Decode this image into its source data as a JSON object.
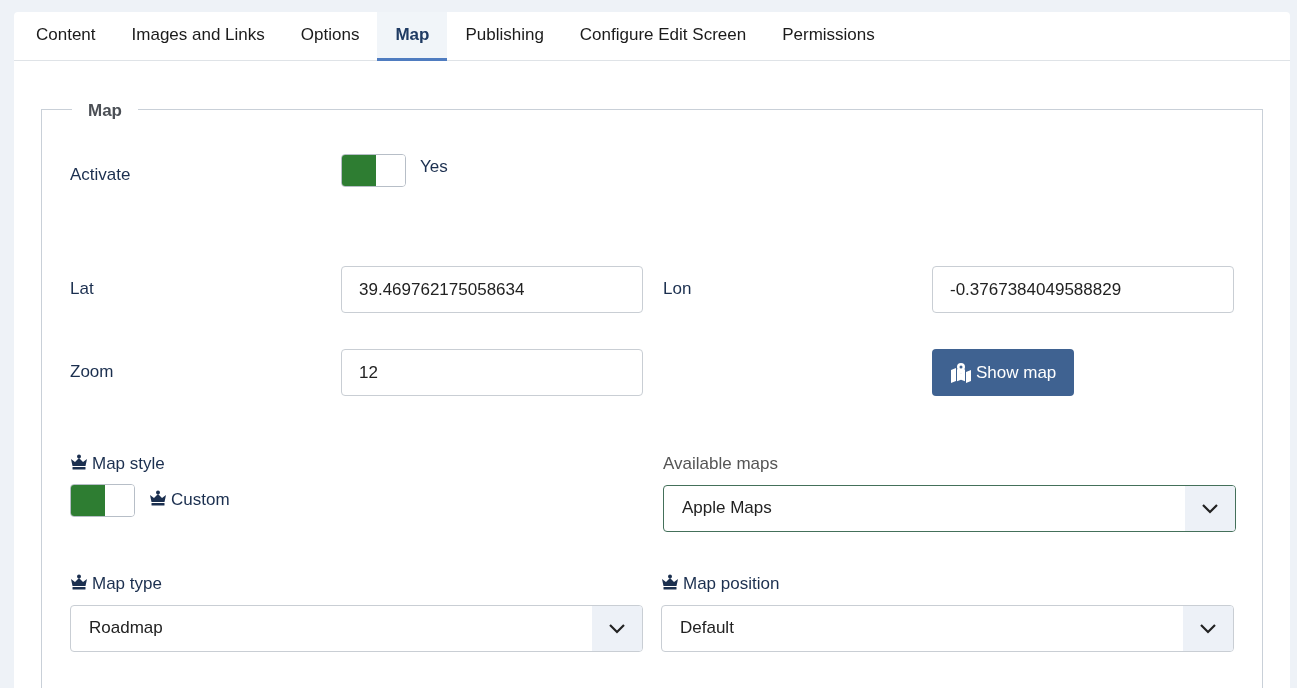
{
  "tabs": [
    {
      "label": "Content",
      "selected": false
    },
    {
      "label": "Images and Links",
      "selected": false
    },
    {
      "label": "Options",
      "selected": false
    },
    {
      "label": "Map",
      "selected": true
    },
    {
      "label": "Publishing",
      "selected": false
    },
    {
      "label": "Configure Edit Screen",
      "selected": false
    },
    {
      "label": "Permissions",
      "selected": false
    }
  ],
  "fieldset": {
    "legend": "Map",
    "activate": {
      "label": "Activate",
      "on": true,
      "state_label": "Yes"
    },
    "lat": {
      "label": "Lat",
      "value": "39.469762175058634"
    },
    "lon": {
      "label": "Lon",
      "value": "-0.3767384049588829"
    },
    "zoom": {
      "label": "Zoom",
      "value": "12"
    },
    "show_map_button": "Show map",
    "map_style": {
      "label": "Map style",
      "on": true,
      "state_label": "Custom"
    },
    "available_maps": {
      "label": "Available maps",
      "value": "Apple Maps"
    },
    "map_type": {
      "label": "Map type",
      "value": "Roadmap"
    },
    "map_position": {
      "label": "Map position",
      "value": "Default"
    }
  }
}
